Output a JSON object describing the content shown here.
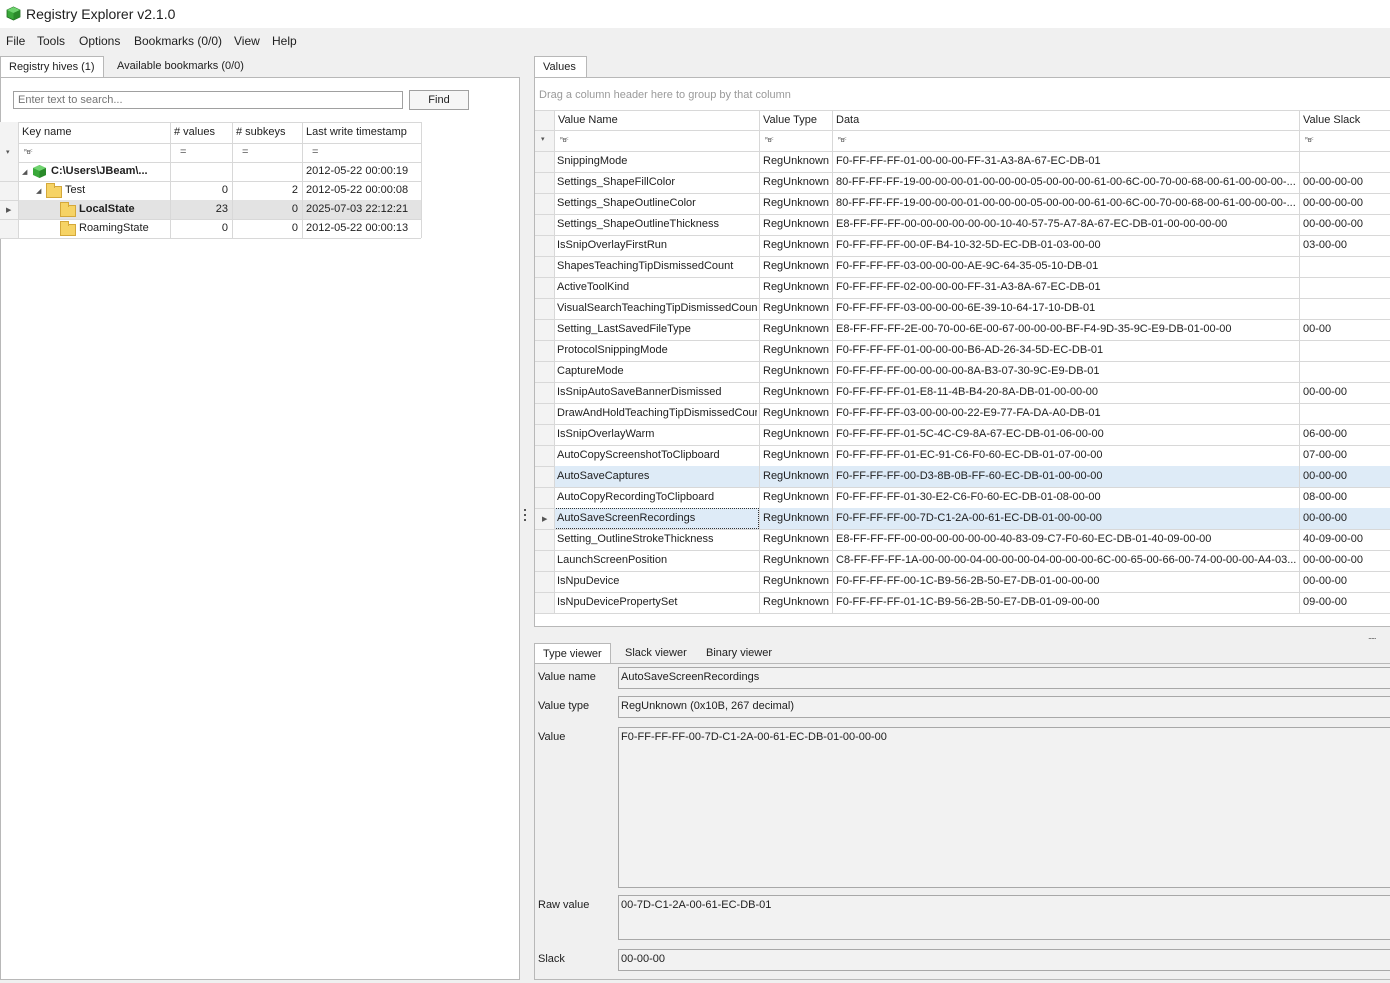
{
  "window": {
    "title": "Registry Explorer v2.1.0"
  },
  "menu": [
    "File",
    "Tools",
    "Options",
    "Bookmarks (0/0)",
    "View",
    "Help"
  ],
  "left_tabs": [
    "Registry hives (1)",
    "Available bookmarks (0/0)"
  ],
  "search": {
    "placeholder": "Enter text to search...",
    "find_label": "Find"
  },
  "tree": {
    "columns": [
      "Key name",
      "# values",
      "# subkeys",
      "Last write timestamp"
    ],
    "filter_abc": "ᴿʙᶜ",
    "filter_eq": "=",
    "rows": [
      {
        "name": "C:\\Users\\JBeam\\...",
        "values": "",
        "subkeys": "",
        "timestamp": "2012-05-22 00:00:19"
      },
      {
        "name": "Test",
        "values": "0",
        "subkeys": "2",
        "timestamp": "2012-05-22 00:00:08"
      },
      {
        "name": "LocalState",
        "values": "23",
        "subkeys": "0",
        "timestamp": "2025-07-03 22:12:21"
      },
      {
        "name": "RoamingState",
        "values": "0",
        "subkeys": "0",
        "timestamp": "2012-05-22 00:00:13"
      }
    ]
  },
  "values_tab": "Values",
  "values": {
    "group_hint": "Drag a column header here to group by that column",
    "columns": [
      "Value Name",
      "Value Type",
      "Data",
      "Value Slack"
    ],
    "rows": [
      {
        "name": "SnippingMode",
        "type": "RegUnknown",
        "data": "F0-FF-FF-FF-01-00-00-00-FF-31-A3-8A-67-EC-DB-01",
        "slack": ""
      },
      {
        "name": "Settings_ShapeFillColor",
        "type": "RegUnknown",
        "data": "80-FF-FF-FF-19-00-00-00-01-00-00-00-05-00-00-00-61-00-6C-00-70-00-68-00-61-00-00-00-...",
        "slack": "00-00-00-00"
      },
      {
        "name": "Settings_ShapeOutlineColor",
        "type": "RegUnknown",
        "data": "80-FF-FF-FF-19-00-00-00-01-00-00-00-05-00-00-00-61-00-6C-00-70-00-68-00-61-00-00-00-...",
        "slack": "00-00-00-00"
      },
      {
        "name": "Settings_ShapeOutlineThickness",
        "type": "RegUnknown",
        "data": "E8-FF-FF-FF-00-00-00-00-00-00-10-40-57-75-A7-8A-67-EC-DB-01-00-00-00-00",
        "slack": "00-00-00-00"
      },
      {
        "name": "IsSnipOverlayFirstRun",
        "type": "RegUnknown",
        "data": "F0-FF-FF-FF-00-0F-B4-10-32-5D-EC-DB-01-03-00-00",
        "slack": "03-00-00"
      },
      {
        "name": "ShapesTeachingTipDismissedCount",
        "type": "RegUnknown",
        "data": "F0-FF-FF-FF-03-00-00-00-AE-9C-64-35-05-10-DB-01",
        "slack": ""
      },
      {
        "name": "ActiveToolKind",
        "type": "RegUnknown",
        "data": "F0-FF-FF-FF-02-00-00-00-FF-31-A3-8A-67-EC-DB-01",
        "slack": ""
      },
      {
        "name": "VisualSearchTeachingTipDismissedCount",
        "type": "RegUnknown",
        "data": "F0-FF-FF-FF-03-00-00-00-6E-39-10-64-17-10-DB-01",
        "slack": ""
      },
      {
        "name": "Setting_LastSavedFileType",
        "type": "RegUnknown",
        "data": "E8-FF-FF-FF-2E-00-70-00-6E-00-67-00-00-00-BF-F4-9D-35-9C-E9-DB-01-00-00",
        "slack": "00-00"
      },
      {
        "name": "ProtocolSnippingMode",
        "type": "RegUnknown",
        "data": "F0-FF-FF-FF-01-00-00-00-B6-AD-26-34-5D-EC-DB-01",
        "slack": ""
      },
      {
        "name": "CaptureMode",
        "type": "RegUnknown",
        "data": "F0-FF-FF-FF-00-00-00-00-8A-B3-07-30-9C-E9-DB-01",
        "slack": ""
      },
      {
        "name": "IsSnipAutoSaveBannerDismissed",
        "type": "RegUnknown",
        "data": "F0-FF-FF-FF-01-E8-11-4B-B4-20-8A-DB-01-00-00-00",
        "slack": "00-00-00"
      },
      {
        "name": "DrawAndHoldTeachingTipDismissedCount",
        "type": "RegUnknown",
        "data": "F0-FF-FF-FF-03-00-00-00-22-E9-77-FA-DA-A0-DB-01",
        "slack": ""
      },
      {
        "name": "IsSnipOverlayWarm",
        "type": "RegUnknown",
        "data": "F0-FF-FF-FF-01-5C-4C-C9-8A-67-EC-DB-01-06-00-00",
        "slack": "06-00-00"
      },
      {
        "name": "AutoCopyScreenshotToClipboard",
        "type": "RegUnknown",
        "data": "F0-FF-FF-FF-01-EC-91-C6-F0-60-EC-DB-01-07-00-00",
        "slack": "07-00-00"
      },
      {
        "name": "AutoSaveCaptures",
        "type": "RegUnknown",
        "data": "F0-FF-FF-FF-00-D3-8B-0B-FF-60-EC-DB-01-00-00-00",
        "slack": "00-00-00"
      },
      {
        "name": "AutoCopyRecordingToClipboard",
        "type": "RegUnknown",
        "data": "F0-FF-FF-FF-01-30-E2-C6-F0-60-EC-DB-01-08-00-00",
        "slack": "08-00-00"
      },
      {
        "name": "AutoSaveScreenRecordings",
        "type": "RegUnknown",
        "data": "F0-FF-FF-FF-00-7D-C1-2A-00-61-EC-DB-01-00-00-00",
        "slack": "00-00-00"
      },
      {
        "name": "Setting_OutlineStrokeThickness",
        "type": "RegUnknown",
        "data": "E8-FF-FF-FF-00-00-00-00-00-00-40-83-09-C7-F0-60-EC-DB-01-40-09-00-00",
        "slack": "40-09-00-00"
      },
      {
        "name": "LaunchScreenPosition",
        "type": "RegUnknown",
        "data": "C8-FF-FF-FF-1A-00-00-00-04-00-00-00-04-00-00-00-6C-00-65-00-66-00-74-00-00-00-A4-03...",
        "slack": "00-00-00-00"
      },
      {
        "name": "IsNpuDevice",
        "type": "RegUnknown",
        "data": "F0-FF-FF-FF-00-1C-B9-56-2B-50-E7-DB-01-00-00-00",
        "slack": "00-00-00"
      },
      {
        "name": "IsNpuDevicePropertySet",
        "type": "RegUnknown",
        "data": "F0-FF-FF-FF-01-1C-B9-56-2B-50-E7-DB-01-09-00-00",
        "slack": "09-00-00"
      }
    ]
  },
  "viewer_tabs": [
    "Type viewer",
    "Slack viewer",
    "Binary viewer"
  ],
  "viewer": {
    "value_name_label": "Value name",
    "value_name": "AutoSaveScreenRecordings",
    "value_type_label": "Value type",
    "value_type": "RegUnknown (0x10B, 267 decimal)",
    "value_label": "Value",
    "value": "F0-FF-FF-FF-00-7D-C1-2A-00-61-EC-DB-01-00-00-00",
    "raw_label": "Raw value",
    "raw": "00-7D-C1-2A-00-61-EC-DB-01",
    "slack_label": "Slack",
    "slack": "00-00-00"
  },
  "colors": {
    "highlight_row": "#deebf7",
    "selected_tree_row": "#e3e3e3",
    "app_icon": "#3aa83a"
  }
}
